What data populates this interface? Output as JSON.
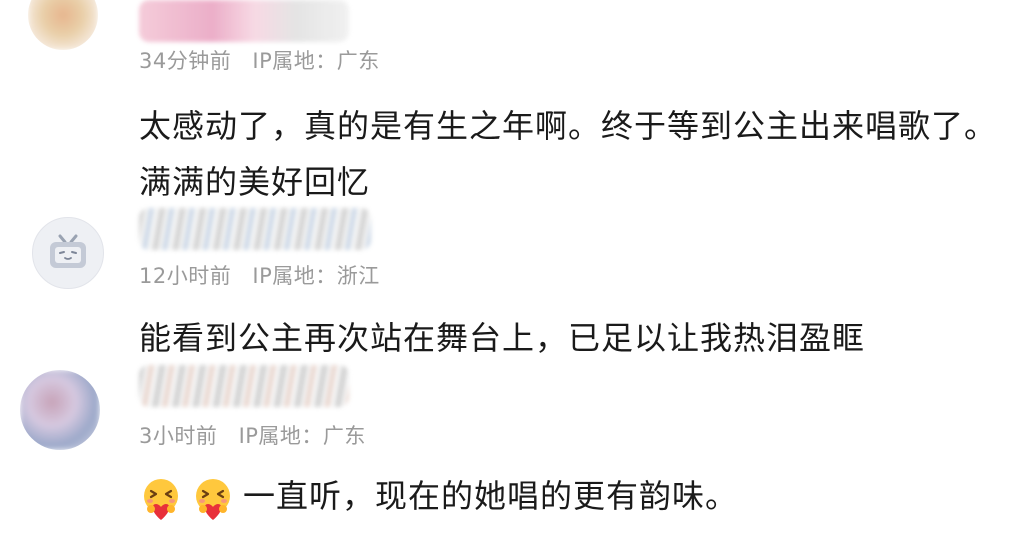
{
  "comments": [
    {
      "time": "34分钟前",
      "ip": "IP属地：广东",
      "text": "太感动了，真的是有生之年啊。终于等到公主出来唱歌了。满满的美好回忆"
    },
    {
      "time": "12小时前",
      "ip": "IP属地：浙江",
      "text": "能看到公主再次站在舞台上，已足以让我热泪盈眶"
    },
    {
      "time": "3小时前",
      "ip": "IP属地：广东",
      "text": "一直听，现在的她唱的更有韵味。",
      "emoji": [
        "hug-emoji",
        "hug-emoji"
      ]
    }
  ],
  "colors": {
    "meta": "#9a9a9a",
    "text": "#1a1a1a",
    "emoji_face": "#ffc83d",
    "emoji_heart": "#e8303a"
  }
}
